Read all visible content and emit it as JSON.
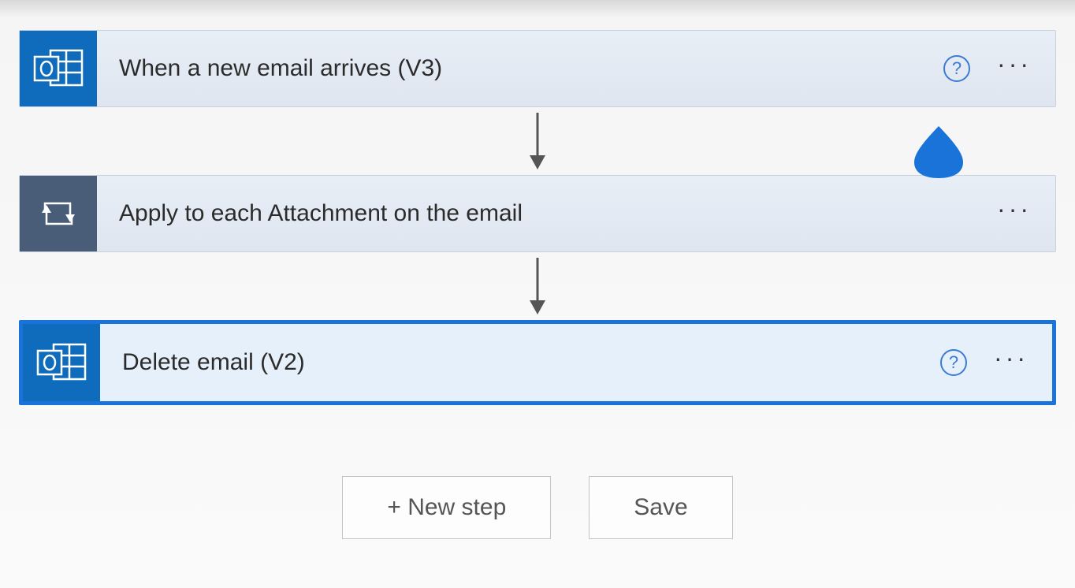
{
  "steps": [
    {
      "title": "When a new email arrives (V3)",
      "icon": "outlook",
      "hasHelp": true,
      "selected": false
    },
    {
      "title": "Apply to each Attachment on the email",
      "icon": "loop",
      "hasHelp": false,
      "selected": false
    },
    {
      "title": "Delete email (V2)",
      "icon": "outlook",
      "hasHelp": true,
      "selected": true
    }
  ],
  "buttons": {
    "newStep": "+ New step",
    "save": "Save"
  },
  "glyphs": {
    "ellipsis": "···",
    "help": "?"
  }
}
